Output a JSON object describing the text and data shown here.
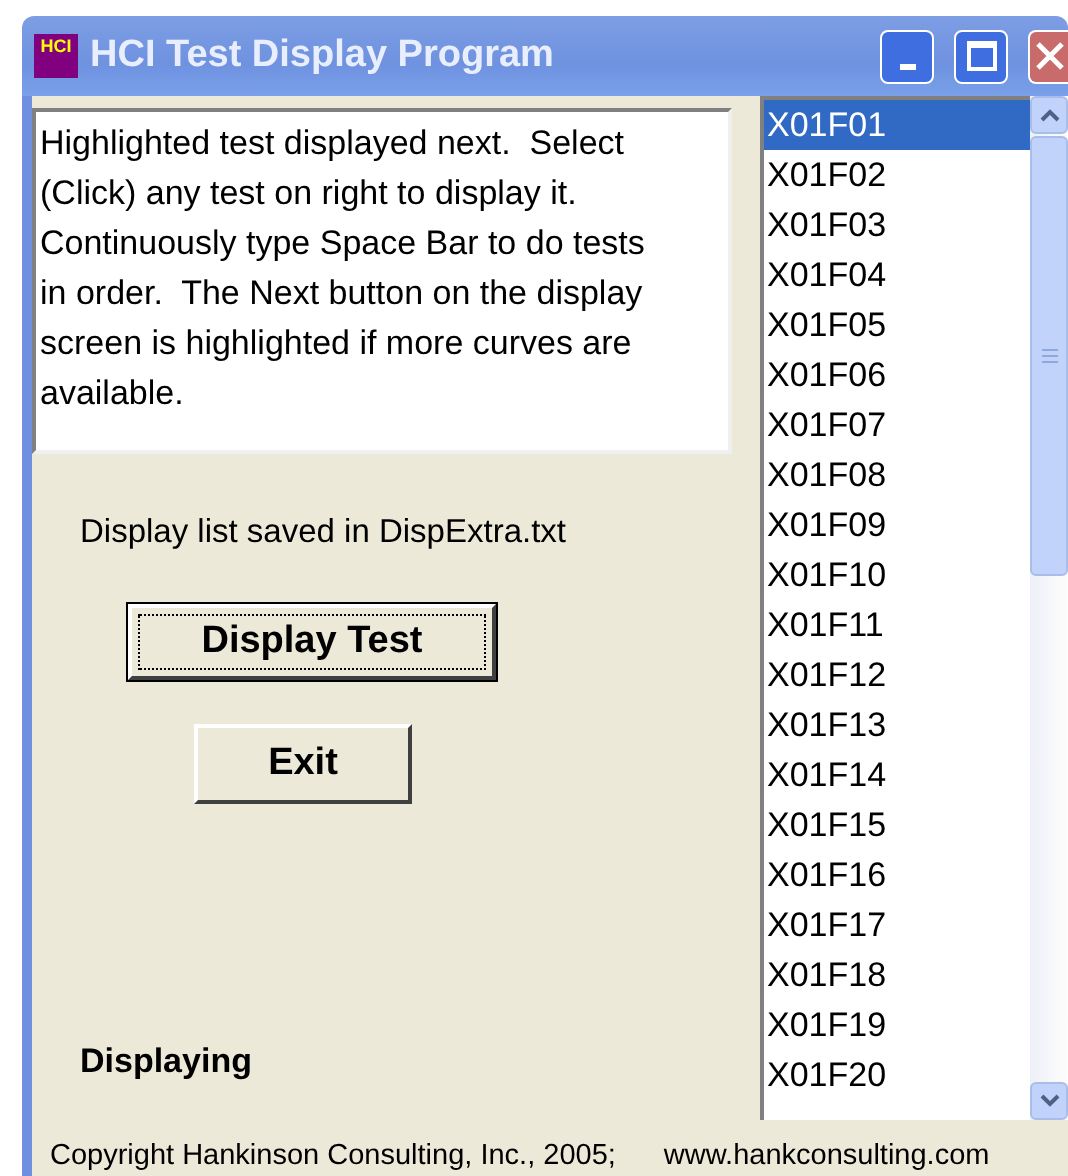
{
  "window": {
    "icon_text": "HCI",
    "title": "HCI Test Display Program"
  },
  "instructions": "Highlighted test displayed next.  Select (Click) any test on right to display it. Continuously type Space Bar to do tests in order.  The Next button on the display screen is highlighted if more curves are available.",
  "saved_message": "Display list saved in DispExtra.txt",
  "buttons": [
    {
      "label": "Display Test",
      "focused": true
    },
    {
      "label": "Exit",
      "focused": false
    }
  ],
  "status": "Displaying",
  "tests": [
    {
      "label": "X01F01",
      "selected": true
    },
    {
      "label": "X01F02",
      "selected": false
    },
    {
      "label": "X01F03",
      "selected": false
    },
    {
      "label": "X01F04",
      "selected": false
    },
    {
      "label": "X01F05",
      "selected": false
    },
    {
      "label": "X01F06",
      "selected": false
    },
    {
      "label": "X01F07",
      "selected": false
    },
    {
      "label": "X01F08",
      "selected": false
    },
    {
      "label": "X01F09",
      "selected": false
    },
    {
      "label": "X01F10",
      "selected": false
    },
    {
      "label": "X01F11",
      "selected": false
    },
    {
      "label": "X01F12",
      "selected": false
    },
    {
      "label": "X01F13",
      "selected": false
    },
    {
      "label": "X01F14",
      "selected": false
    },
    {
      "label": "X01F15",
      "selected": false
    },
    {
      "label": "X01F16",
      "selected": false
    },
    {
      "label": "X01F17",
      "selected": false
    },
    {
      "label": "X01F18",
      "selected": false
    },
    {
      "label": "X01F19",
      "selected": false
    },
    {
      "label": "X01F20",
      "selected": false
    }
  ],
  "footer": {
    "copyright": "Copyright Hankinson Consulting, Inc., 2005;",
    "website": "www.hankconsulting.com"
  }
}
